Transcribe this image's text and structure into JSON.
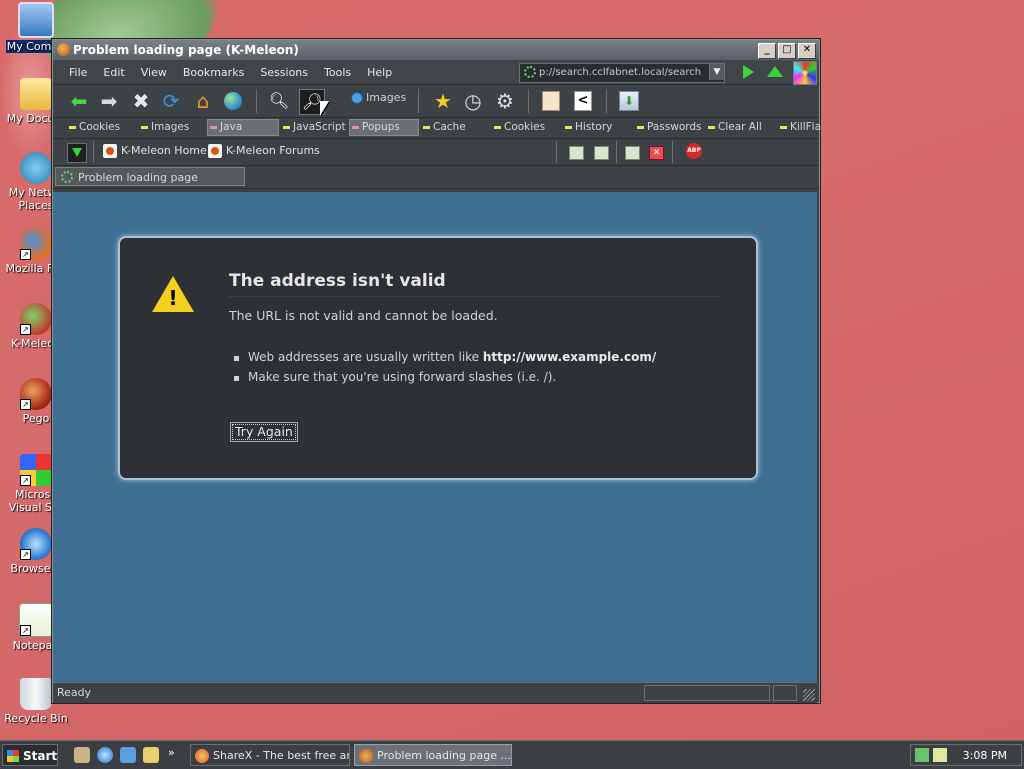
{
  "desktop": {
    "icons": [
      {
        "label": "My Compu",
        "name": "my-computer"
      },
      {
        "label": "My Docum",
        "name": "my-documents"
      },
      {
        "label": "My Netwo Places",
        "name": "my-network-places"
      },
      {
        "label": "Mozilla Fire",
        "name": "mozilla-firefox"
      },
      {
        "label": "K-Meleon",
        "name": "k-meleon"
      },
      {
        "label": "Pego",
        "name": "pego"
      },
      {
        "label": "Microso Visual Stu",
        "name": "microsoft-visual-studio"
      },
      {
        "label": "Browserv",
        "name": "browserv"
      },
      {
        "label": "Notepad",
        "name": "notepad"
      },
      {
        "label": "Recycle Bin",
        "name": "recycle-bin"
      }
    ]
  },
  "window": {
    "title": "Problem loading page (K-Meleon)",
    "controls": {
      "minimize": "_",
      "maximize": "□",
      "close": "✕"
    }
  },
  "menu": [
    "File",
    "Edit",
    "View",
    "Bookmarks",
    "Sessions",
    "Tools",
    "Help"
  ],
  "address": {
    "value": "p://search.cclfabnet.local/search"
  },
  "toolbar": {
    "images_label": "Images"
  },
  "privacy": [
    "Cookies",
    "Images",
    "Java",
    "JavaScript",
    "Popups",
    "Cache",
    "Cookies",
    "History",
    "Passwords",
    "Clear All",
    "KillFla"
  ],
  "links": {
    "home": "K-Meleon Home",
    "forums": "K-Meleon Forums"
  },
  "tab": {
    "label": "Problem loading page"
  },
  "error": {
    "title": "The address isn't valid",
    "description": "The URL is not valid and cannot be loaded.",
    "bullet1_prefix": "Web addresses are usually written like ",
    "bullet1_example": "http://www.example.com/",
    "bullet2": "Make sure that you're using forward slashes (i.e. /).",
    "try_again": "Try Again"
  },
  "status": {
    "text": "Ready"
  },
  "taskbar": {
    "start": "Start",
    "tasks": [
      {
        "label": "ShareX - The best free an...",
        "active": false
      },
      {
        "label": "Problem loading page ...",
        "active": true
      }
    ],
    "clock": "3:08 PM"
  },
  "colors": {
    "content_bg": "#3e6f92",
    "dialog_bg": "#2d3035",
    "warning": "#f4d11e",
    "accent_green": "#3bd13b"
  }
}
